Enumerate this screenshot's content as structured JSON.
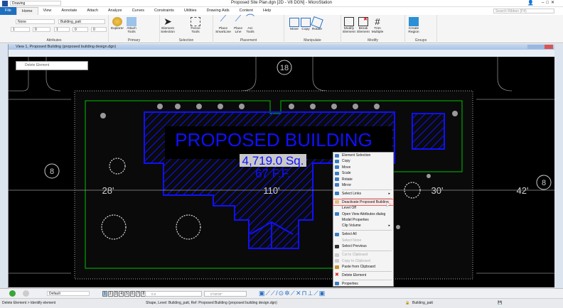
{
  "app": {
    "workflow": "Drawing",
    "title": "Proposed Site Plan.dgn [2D - V8 DGN] - MicroStation",
    "search_placeholder": "Search Ribbon (F4)"
  },
  "tabs": [
    "File",
    "Home",
    "View",
    "Annotate",
    "Attach",
    "Analyze",
    "Curves",
    "Constraints",
    "Utilities",
    "Drawing Aids",
    "Content",
    "Help"
  ],
  "ribbon": {
    "attributes": {
      "label": "Attributes",
      "level_display": "None",
      "level": "Building_patt",
      "color": "1",
      "style": "0",
      "weight": "1",
      "transparency": "0",
      "priority": "0"
    },
    "primary": {
      "label": "Primary",
      "explorer": "Explorer",
      "attach_tools": "Attach Tools"
    },
    "selection": {
      "label": "Selection",
      "element_selection": "Element Selection",
      "fence_tools": "Fence Tools"
    },
    "placement": {
      "label": "Placement",
      "place_smartline": "Place SmartLine",
      "place_line": "Place Line",
      "arc_tools": "Arc Tools"
    },
    "manipulate": {
      "label": "Manipulate",
      "move": "Move",
      "copy": "Copy",
      "rotate": "Rotate"
    },
    "modify": {
      "label": "Modify",
      "modify_element": "Modify Element",
      "break_element": "Break Element",
      "trim_multiple": "Trim Multiple"
    },
    "groups": {
      "label": "Groups",
      "create_region": "Create Region"
    }
  },
  "view": {
    "title": "View 1, Proposed Building (proposed building design.dgn)"
  },
  "dialog": {
    "title": "Delete Element"
  },
  "drawing": {
    "building_label": "PROPOSED BUILDING",
    "area": "4,719.0 Sq.",
    "floor": "67 F.F.",
    "dims": [
      "28'",
      "110'",
      "30'",
      "42'"
    ],
    "markers": [
      "8",
      "18",
      "8"
    ],
    "colors": {
      "building": "#1010ff",
      "boundary": "#00c000",
      "selection": "#d0d0d0"
    }
  },
  "context_menu": {
    "items": [
      {
        "label": "Element Selection",
        "enabled": true
      },
      {
        "label": "Copy",
        "enabled": true
      },
      {
        "label": "Move",
        "enabled": true
      },
      {
        "label": "Scale",
        "enabled": true
      },
      {
        "label": "Rotate",
        "enabled": true
      },
      {
        "label": "Mirror",
        "enabled": true
      },
      {
        "label": "Select Links",
        "enabled": true,
        "submenu": true
      },
      {
        "label": "Deactivate Proposed Building",
        "enabled": true,
        "highlighted": true
      },
      {
        "label": "Level Off",
        "enabled": true
      },
      {
        "label": "Open View Attributes dialog",
        "enabled": true
      },
      {
        "label": "Model Properties",
        "enabled": true
      },
      {
        "label": "Clip Volume",
        "enabled": true,
        "submenu": true
      },
      {
        "label": "Select All",
        "enabled": true
      },
      {
        "label": "Select None",
        "enabled": false
      },
      {
        "label": "Select Previous",
        "enabled": true
      },
      {
        "label": "Cut to Clipboard",
        "enabled": false
      },
      {
        "label": "Copy to Clipboard",
        "enabled": false
      },
      {
        "label": "Paste from Clipboard",
        "enabled": true
      },
      {
        "label": "Delete Element",
        "enabled": true
      },
      {
        "label": "Properties",
        "enabled": true
      }
    ]
  },
  "bottom": {
    "view_group": "Default",
    "views": [
      "1",
      "2",
      "3",
      "4",
      "5",
      "6",
      "7",
      "8"
    ],
    "distance": "0.0",
    "angle": "0°00'00\""
  },
  "status": {
    "prompt": "Delete Element > Identify element",
    "message": "Shape, Level: Building_patt, Ref: Proposed Building (proposed building design.dgn)",
    "active_level": "Building_patt"
  }
}
